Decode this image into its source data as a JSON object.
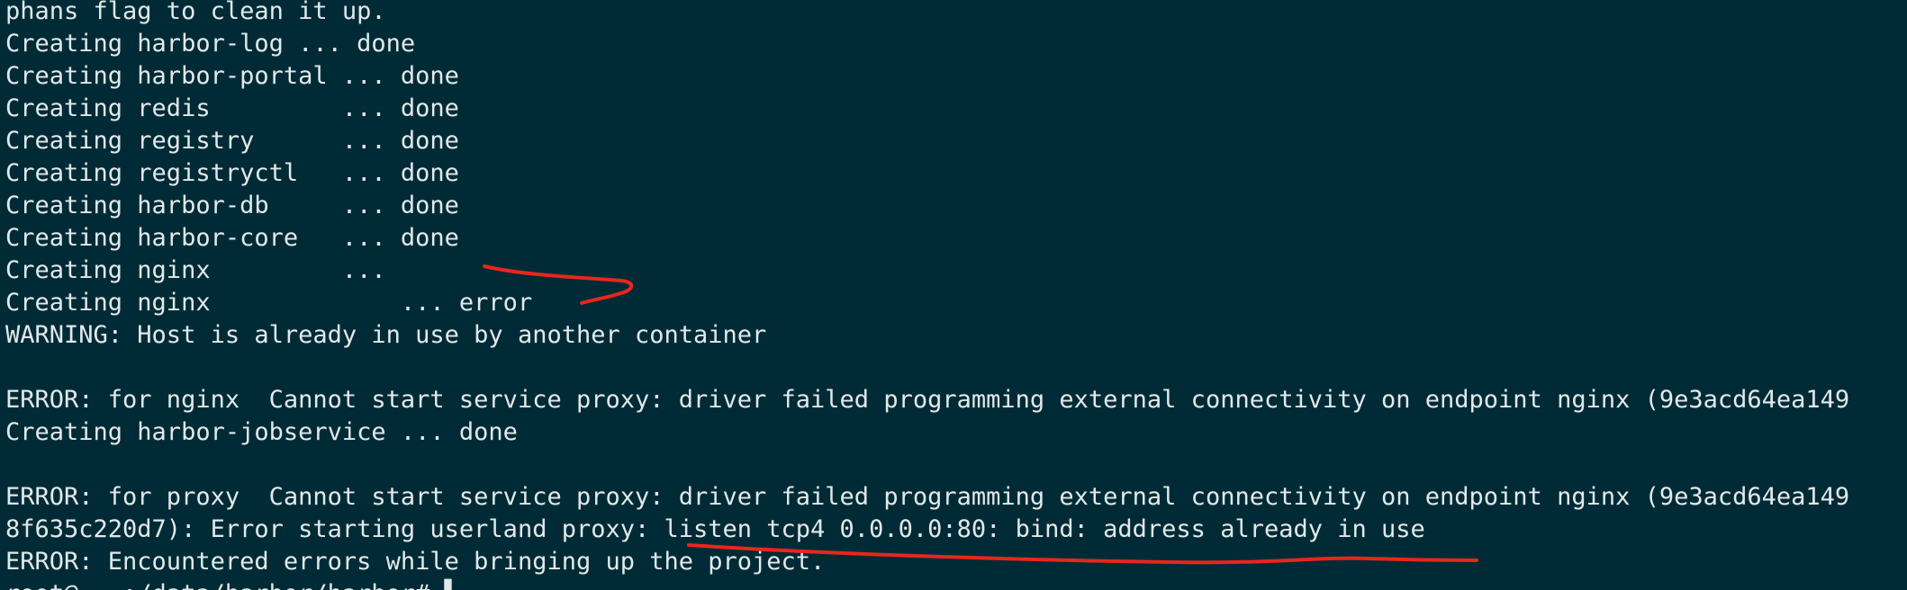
{
  "terminal": {
    "lines": [
      "phans flag to clean it up.",
      "Creating harbor-log ... done",
      "Creating harbor-portal ... done",
      "Creating redis         ... done",
      "Creating registry      ... done",
      "Creating registryctl   ... done",
      "Creating harbor-db     ... done",
      "Creating harbor-core   ... done",
      "Creating nginx         ... ",
      "Creating nginx             ... error",
      "WARNING: Host is already in use by another container",
      "",
      "ERROR: for nginx  Cannot start service proxy: driver failed programming external connectivity on endpoint nginx (9e3acd64ea149",
      "Creating harbor-jobservice ... done",
      "",
      "ERROR: for proxy  Cannot start service proxy: driver failed programming external connectivity on endpoint nginx (9e3acd64ea149",
      "8f635c220d7): Error starting userland proxy: listen tcp4 0.0.0.0:80: bind: address already in use",
      "ERROR: Encountered errors while bringing up the project.",
      "root@...:/data/harbor/harbor# ▌"
    ]
  },
  "colors": {
    "background": "#002b36",
    "text": "#e2e9ea",
    "annotation": "#e8261c"
  }
}
